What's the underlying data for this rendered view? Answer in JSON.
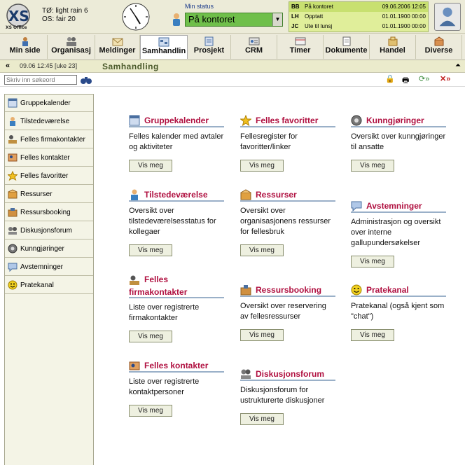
{
  "app": {
    "logo_text": "XS Office",
    "weather_line1": "TØ: light rain 6",
    "weather_line2": "OS: fair 20"
  },
  "status": {
    "label": "Min status",
    "value": "På kontoret"
  },
  "userlist": [
    {
      "ini": "BB",
      "text": "På kontoret",
      "date": "09.06.2006 12:05"
    },
    {
      "ini": "LH",
      "text": "Opptatt",
      "date": "01.01.1900 00:00"
    },
    {
      "ini": "JC",
      "text": "Ute til lunsj",
      "date": "01.01.1900 00:00"
    }
  ],
  "tabs": [
    {
      "label": "Min side",
      "icon": "person-icon"
    },
    {
      "label": "Organisasj",
      "icon": "people-icon"
    },
    {
      "label": "Meldinger",
      "icon": "envelope-icon"
    },
    {
      "label": "Samhandlin",
      "icon": "collaboration-icon"
    },
    {
      "label": "Prosjekt",
      "icon": "project-icon"
    },
    {
      "label": "CRM",
      "icon": "crm-icon"
    },
    {
      "label": "Timer",
      "icon": "timer-icon"
    },
    {
      "label": "Dokumente",
      "icon": "document-icon"
    },
    {
      "label": "Handel",
      "icon": "trade-icon"
    },
    {
      "label": "Diverse",
      "icon": "misc-icon"
    }
  ],
  "crumb": {
    "back": "«",
    "date": "09.06 12:45 [uke 23]",
    "title": "Samhandling",
    "up": "«"
  },
  "search": {
    "placeholder": "Skriv inn søkeord"
  },
  "sidebar": {
    "items": [
      {
        "label": "Gruppekalender",
        "icon": "calendar-icon"
      },
      {
        "label": "Tilstedeværelse",
        "icon": "person-icon"
      },
      {
        "label": "Felles firmakontakter",
        "icon": "company-contacts-icon"
      },
      {
        "label": "Felles kontakter",
        "icon": "contacts-icon"
      },
      {
        "label": "Felles favoritter",
        "icon": "star-icon"
      },
      {
        "label": "Ressurser",
        "icon": "box-icon"
      },
      {
        "label": "Ressursbooking",
        "icon": "booking-icon"
      },
      {
        "label": "Diskusjonsforum",
        "icon": "forum-icon"
      },
      {
        "label": "Kunngjøringer",
        "icon": "announcement-icon"
      },
      {
        "label": "Avstemninger",
        "icon": "poll-icon"
      },
      {
        "label": "Pratekanal",
        "icon": "smiley-icon"
      }
    ]
  },
  "button_label": "Vis meg",
  "cards": [
    {
      "title": "Gruppekalender",
      "desc": "Felles kalender med avtaler og aktiviteter",
      "icon": "calendar-icon"
    },
    {
      "title": "Felles favoritter",
      "desc": "Fellesregister for favoritter/linker",
      "icon": "star-icon"
    },
    {
      "title": "Kunngjøringer",
      "desc": "Oversikt over kunngjøringer til ansatte",
      "icon": "announcement-icon"
    },
    {
      "title": "Tilstedeværelse",
      "desc": "Oversikt over tilstedeværelsesstatus for kollegaer",
      "icon": "person-icon"
    },
    {
      "title": "Ressurser",
      "desc": "Oversikt over organisasjonens ressurser for fellesbruk",
      "icon": "box-icon"
    },
    {
      "title": "Avstemninger",
      "desc": "Administrasjon og oversikt over interne gallupundersøkelser",
      "icon": "poll-icon"
    },
    {
      "title": "Felles firmakontakter",
      "desc": "Liste over registrerte firmakontakter",
      "icon": "company-contacts-icon"
    },
    {
      "title": "Ressursbooking",
      "desc": "Oversikt over reservering av fellesressurser",
      "icon": "booking-icon"
    },
    {
      "title": "Pratekanal",
      "desc": "Pratekanal (også kjent som \"chat\")",
      "icon": "smiley-icon"
    },
    {
      "title": "Felles kontakter",
      "desc": "Liste over registrerte kontaktpersoner",
      "icon": "contacts-icon"
    },
    {
      "title": "Diskusjonsforum",
      "desc": "Diskusjonsforum for ustrukturerte diskusjoner",
      "icon": "forum-icon"
    }
  ],
  "colors": {
    "card_title": "#b01040",
    "status_green": "#6fbf4a",
    "userlist_bg": "#e0ee9a"
  }
}
